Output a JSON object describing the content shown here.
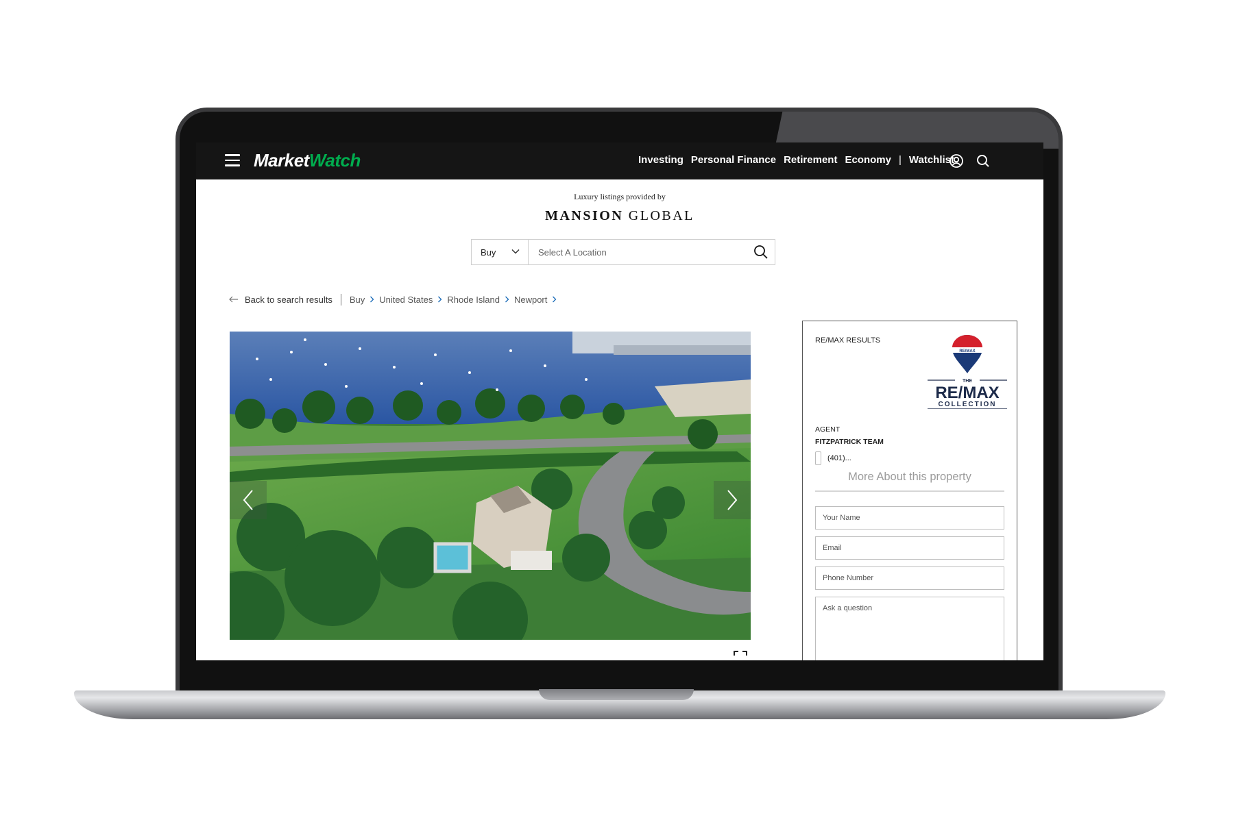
{
  "header": {
    "logo_part1": "Market",
    "logo_part2": "Watch",
    "nav": [
      "Investing",
      "Personal Finance",
      "Retirement",
      "Economy"
    ],
    "nav_separator": "|",
    "watchlist": "Watchlist",
    "icons": [
      "menu-icon",
      "account-icon",
      "search-icon"
    ],
    "colors": {
      "background": "#151515",
      "logo_accent": "#00ac4e"
    }
  },
  "mansion": {
    "provided_by": "Luxury listings provided by",
    "brand_bold": "MANSION",
    "brand_light": "GLOBAL"
  },
  "search": {
    "type_value": "Buy",
    "location_placeholder": "Select A Location"
  },
  "breadcrumbs": {
    "back": "Back to search results",
    "items": [
      "Buy",
      "United States",
      "Rhode Island",
      "Newport"
    ]
  },
  "agent_card": {
    "heading": "RE/MAX RESULTS",
    "logo_text_main": "RE/MAX",
    "logo_text_the": "THE",
    "logo_text_collection": "COLLECTION",
    "agent_label": "AGENT",
    "agent_name": "FITZPATRICK TEAM",
    "phone": "(401)...",
    "more_about": "More About this property",
    "fields": {
      "name_placeholder": "Your Name",
      "email_placeholder": "Email",
      "phone_placeholder": "Phone Number",
      "question_placeholder": "Ask a question"
    },
    "colors": {
      "remax_red": "#d4202c",
      "remax_blue": "#1b3a78",
      "remax_navy": "#1d2b4a"
    }
  }
}
